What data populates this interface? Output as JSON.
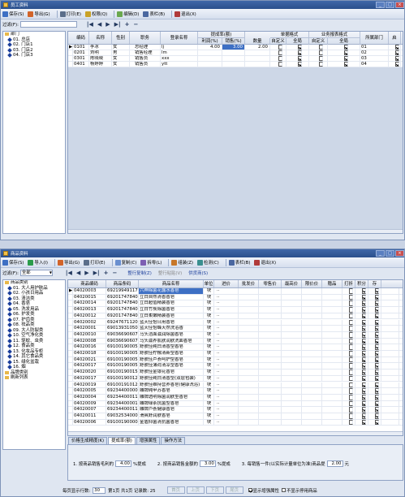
{
  "emp": {
    "title": "员工资料",
    "toolbar": [
      {
        "icon": "save-icon",
        "label": "保存(S)",
        "color": "#3d6fc4"
      },
      {
        "icon": "export-icon",
        "label": "导出(G)",
        "color": "#d2642a"
      },
      {
        "icon": "print-icon",
        "label": "打印(E)",
        "color": "#5b6e8a"
      },
      {
        "icon": "permission-icon",
        "label": "权限(Q)",
        "color": "#c9a227"
      },
      {
        "icon": "edit-icon",
        "label": "编辑(D)",
        "color": "#6aa84f"
      },
      {
        "icon": "layout-icon",
        "label": "表栏(B)",
        "color": "#4a67a0"
      },
      {
        "icon": "exit-icon",
        "label": "退出(X)",
        "color": "#b03a3a"
      }
    ],
    "filter_label": "过滤(F):",
    "nav": [
      "|◀",
      "◀",
      "▶",
      "▶|",
      "+",
      "−"
    ],
    "tree": [
      {
        "label": "部门",
        "type": "folder"
      },
      {
        "label": "01. 总店",
        "type": "node"
      },
      {
        "label": "02. 门店1",
        "type": "node"
      },
      {
        "label": "03. 门店2",
        "type": "node"
      },
      {
        "label": "04. 门店3",
        "type": "node"
      }
    ],
    "headers_top": [
      {
        "label": "提成率(额)"
      },
      {
        "label": "单据格式"
      },
      {
        "label": "业务报表格式"
      }
    ],
    "headers": [
      "编码",
      "名称",
      "性别",
      "职务",
      "登录名称",
      "利润(%)",
      "销售(%)",
      "数量",
      "自定义",
      "全局",
      "自定义",
      "全局",
      "所属部门",
      "启"
    ],
    "rows": [
      {
        "code": "0101",
        "name": "李冰",
        "sex": "女",
        "title": "总经理",
        "login": "lj",
        "profit": "4.00",
        "sales": "3.00",
        "qty": "2.00",
        "c1": false,
        "c2": true,
        "c3": false,
        "c4": true,
        "dept": "01",
        "en": true
      },
      {
        "code": "0201",
        "name": "刘明",
        "sex": "男",
        "title": "销售经理",
        "login": "lm",
        "profit": "",
        "sales": "",
        "qty": "",
        "c1": false,
        "c2": true,
        "c3": false,
        "c4": true,
        "dept": "02",
        "en": true
      },
      {
        "code": "0301",
        "name": "陈晓晓",
        "sex": "女",
        "title": "销售员",
        "login": "xxx",
        "profit": "",
        "sales": "",
        "qty": "",
        "c1": false,
        "c2": true,
        "c3": false,
        "c4": true,
        "dept": "03",
        "en": true
      },
      {
        "code": "0401",
        "name": "杨婷婷",
        "sex": "女",
        "title": "销售员",
        "login": "ytt",
        "profit": "",
        "sales": "",
        "qty": "",
        "c1": false,
        "c2": true,
        "c3": false,
        "c4": true,
        "dept": "04",
        "en": true
      }
    ]
  },
  "prod": {
    "title": "商品资料",
    "toolbar": [
      {
        "icon": "save-icon",
        "label": "保存(S)",
        "color": "#3d6fc4"
      },
      {
        "icon": "import-icon",
        "label": "导入(I)",
        "color": "#2a9c4a"
      },
      {
        "icon": "export-icon",
        "label": "导出(G)",
        "color": "#d2642a"
      },
      {
        "icon": "print-icon",
        "label": "打印(E)",
        "color": "#5b6e8a"
      },
      {
        "icon": "copy-icon",
        "label": "复制(C)",
        "color": "#6a8fcf"
      },
      {
        "icon": "split-icon",
        "label": "拆零(L)",
        "color": "#7d5fb3"
      },
      {
        "icon": "combine-icon",
        "label": "组装(Z)",
        "color": "#c7772a"
      },
      {
        "icon": "check-icon",
        "label": "检测(C)",
        "color": "#3a8f8f"
      },
      {
        "icon": "layout-icon",
        "label": "表栏(B)",
        "color": "#4a67a0"
      },
      {
        "icon": "exit-icon",
        "label": "退出(X)",
        "color": "#b03a3a"
      }
    ],
    "filter_label": "过滤(F):",
    "filter_value": "全部",
    "nav": [
      "|◀",
      "◀",
      "▶",
      "▶|",
      "+",
      "−"
    ],
    "links": [
      "整行复制(Z)",
      "整行粘贴(V)",
      "供货商(S)"
    ],
    "tree": [
      {
        "label": "商品类别",
        "type": "folder",
        "indent": 0
      },
      {
        "label": "01. 大人用护肤品",
        "type": "node",
        "indent": 1
      },
      {
        "label": "02. 小孩日用品",
        "type": "node",
        "indent": 1
      },
      {
        "label": "03. 清洁类",
        "type": "node",
        "indent": 1
      },
      {
        "label": "04. 香皂",
        "type": "node",
        "indent": 1
      },
      {
        "label": "05. 洗发用品",
        "type": "node",
        "indent": 1
      },
      {
        "label": "06. 护发类",
        "type": "node",
        "indent": 1
      },
      {
        "label": "07. 护齿类",
        "type": "node",
        "indent": 1
      },
      {
        "label": "08. 祛品类",
        "type": "node",
        "indent": 1
      },
      {
        "label": "09. 大人防裂类",
        "type": "node",
        "indent": 1
      },
      {
        "label": "10. 空气净化类",
        "type": "node",
        "indent": 1
      },
      {
        "label": "11. 驱蚊、虫类",
        "type": "node",
        "indent": 1
      },
      {
        "label": "12. 食品类",
        "type": "node",
        "indent": 1
      },
      {
        "label": "13. 化妆品专柜",
        "type": "node",
        "indent": 1
      },
      {
        "label": "14. 其它食品类",
        "type": "node",
        "indent": 1
      },
      {
        "label": "15. 绿化盆栽",
        "type": "node",
        "indent": 1
      },
      {
        "label": "16. 烟",
        "type": "node",
        "indent": 1
      },
      {
        "label": "品牌类别",
        "type": "folder",
        "indent": 0
      },
      {
        "label": "刷新列表",
        "type": "folder",
        "indent": 0
      }
    ],
    "headers": [
      "商品编码",
      "商品条码",
      "商品名称",
      "单位",
      "进价",
      "批发价",
      "零售价",
      "最高价",
      "限价价",
      "赠品",
      "打折",
      "积分",
      "存"
    ],
    "rows": [
      {
        "code": "04020003",
        "bar": "6921994911759",
        "name": "六神除菌花露水香皂",
        "unit": "块",
        "disc": true,
        "pts": true,
        "sel": true
      },
      {
        "code": "04020015",
        "bar": "6920174784094",
        "name": "立白自然清香香皂",
        "unit": "块",
        "disc": true,
        "pts": true
      },
      {
        "code": "04020014",
        "bar": "6920174784022",
        "name": "立白超值精装香皂",
        "unit": "块",
        "disc": true,
        "pts": true
      },
      {
        "code": "04020013",
        "bar": "6920174784015",
        "name": "立白竹炭除菌香皂",
        "unit": "块",
        "disc": true,
        "pts": true
      },
      {
        "code": "04020012",
        "bar": "6920174784053",
        "name": "立白柔嫩精装香皂",
        "unit": "块",
        "disc": true,
        "pts": true
      },
      {
        "code": "04020002",
        "bar": "6924767112025",
        "name": "蓝天佳怡日用香皂",
        "unit": "块",
        "disc": true,
        "pts": true
      },
      {
        "code": "04020001",
        "bar": "6901393105075",
        "name": "蓝天佳怡蜂天然洗浴香",
        "unit": "块",
        "disc": true,
        "pts": true
      },
      {
        "code": "04020010",
        "bar": "6903669060789",
        "name": "马头洁面滋润除菌香皂",
        "unit": "块",
        "disc": true,
        "pts": true
      },
      {
        "code": "04020008",
        "bar": "6903669060795",
        "name": "马头滋养肌肤润肤洗面香皂",
        "unit": "块",
        "disc": true,
        "pts": true
      },
      {
        "code": "04020016",
        "bar": "6910019000563",
        "name": "舒肤佳纯白清香型香皂",
        "unit": "块",
        "disc": true,
        "pts": true
      },
      {
        "code": "04020018",
        "bar": "6910019000563",
        "name": "舒肤佳柠檬清新型香皂",
        "unit": "块",
        "disc": true,
        "pts": true
      },
      {
        "code": "04020021",
        "bar": "6910019000561",
        "name": "舒肤佳芦荟呵护型香皂",
        "unit": "块",
        "disc": true,
        "pts": true
      },
      {
        "code": "04020017",
        "bar": "6910019000563",
        "name": "舒肤佳薄荷清凉型香皂",
        "unit": "块",
        "disc": true,
        "pts": true
      },
      {
        "code": "04020020",
        "bar": "6910019001505",
        "name": "舒肤佳金银花香皂",
        "unit": "块",
        "disc": true,
        "pts": true
      },
      {
        "code": "04020017",
        "bar": "6910019001256",
        "name": "舒肤佳纯白清香型(双层包装)",
        "unit": "块",
        "disc": true,
        "pts": true
      },
      {
        "code": "04020019",
        "bar": "6910019101251",
        "name": "舒肤佳维持营养香皂(健康洗浴)",
        "unit": "块",
        "disc": true,
        "pts": true
      },
      {
        "code": "04020005",
        "bar": "6923440000017",
        "name": "雕牌纯甲苏香皂",
        "unit": "块",
        "disc": true,
        "pts": true
      },
      {
        "code": "04020004",
        "bar": "6923440001138",
        "name": "雕牌透明除菌润肤型香皂",
        "unit": "块",
        "disc": true,
        "pts": true
      },
      {
        "code": "04020009",
        "bar": "6923440000185",
        "name": "雕牌绿茶抗菌型香皂",
        "unit": "块",
        "disc": true,
        "pts": true
      },
      {
        "code": "04020007",
        "bar": "6923440001181",
        "name": "雕牌芦荟健康香皂",
        "unit": "块",
        "disc": true,
        "pts": true
      },
      {
        "code": "04020011",
        "bar": "6903253400066",
        "name": "滑爽舒润肤香皂",
        "unit": "块",
        "disc": true,
        "pts": true
      },
      {
        "code": "04020006",
        "bar": "6910019000025",
        "name": "金盾抑菌清抗菌香皂",
        "unit": "块",
        "disc": true,
        "pts": true
      }
    ],
    "tabs": [
      "价格生成精度(K)",
      "提成率(额)",
      "增强属性",
      "操作方法"
    ],
    "active_tab": 1,
    "panel": {
      "f1_label": "1. 按商品销售毛利的",
      "f1_value": "4.00",
      "f1_unit": "%提成",
      "f2_label": "2. 按商品销售金额的",
      "f2_value": "3.00",
      "f2_unit": "%提成",
      "f3_label": "3. 每销售一件(以实际计量单位为准)商品提",
      "f3_value": "2.00",
      "f3_unit": "元"
    },
    "footer": {
      "per_page_label": "每页显示行数:",
      "per_page": "30",
      "page_info": "第1页 共1页 记录数: 25",
      "buttons": [
        "首页",
        "上页",
        "下页",
        "尾页"
      ],
      "chk1": "显示增强属性",
      "chk2": "不显示停用商品"
    }
  }
}
